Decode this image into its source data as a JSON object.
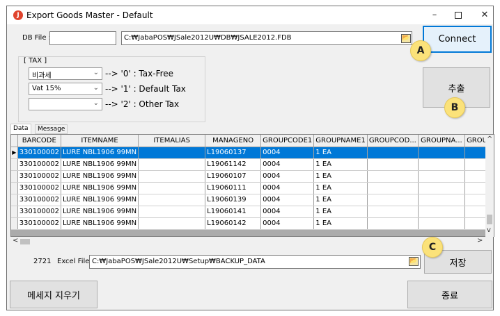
{
  "window": {
    "title": "Export Goods Master - Default",
    "controls": {
      "minimize": "–",
      "maximize": "",
      "close": "✕"
    }
  },
  "db": {
    "label": "DB File :",
    "path": "C:₩JabaPOS₩JSale2012U₩DB₩JSALE2012.FDB",
    "connect_label": "Connect"
  },
  "tax": {
    "group_title": "[ TAX ]",
    "rows": [
      {
        "combo": "비과세",
        "text": "--> '0' : Tax-Free"
      },
      {
        "combo": "Vat 15%",
        "text": "--> '1' : Default Tax"
      },
      {
        "combo": "",
        "text": "--> '2' : Other Tax"
      }
    ]
  },
  "extract_label": "추출",
  "tabs": {
    "data": "Data",
    "message": "Message"
  },
  "grid": {
    "columns": [
      "BARCODE",
      "ITEMNAME",
      "ITEMALIAS",
      "MANAGENO",
      "GROUPCODE1",
      "GROUPNAME1",
      "GROUPCOD...",
      "GROUPNA...",
      "GROUP"
    ],
    "rows": [
      [
        "330100002",
        "LURE NBL1906 99MN",
        "",
        "L19060137",
        "0004",
        "1 EA",
        "",
        "",
        ""
      ],
      [
        "330100002",
        "LURE NBL1906 99MN",
        "",
        "L19061142",
        "0004",
        "1 EA",
        "",
        "",
        ""
      ],
      [
        "330100002",
        "LURE NBL1906 99MN",
        "",
        "L19060107",
        "0004",
        "1 EA",
        "",
        "",
        ""
      ],
      [
        "330100002",
        "LURE NBL1906 99MN",
        "",
        "L19060111",
        "0004",
        "1 EA",
        "",
        "",
        ""
      ],
      [
        "330100002",
        "LURE NBL1906 99MN",
        "",
        "L19060139",
        "0004",
        "1 EA",
        "",
        "",
        ""
      ],
      [
        "330100002",
        "LURE NBL1906 99MN",
        "",
        "L19060141",
        "0004",
        "1 EA",
        "",
        "",
        ""
      ],
      [
        "330100002",
        "LURE NBL1906 99MN",
        "",
        "L19060142",
        "0004",
        "1 EA",
        "",
        "",
        ""
      ]
    ]
  },
  "scroll": {
    "up": "^",
    "down": "v",
    "left": "<",
    "right": ">"
  },
  "export": {
    "count": "2721",
    "label": "Excel File :",
    "path": "C:₩JabaPOS₩JSale2012U₩Setup₩BACKUP_DATA",
    "save_label": "저장"
  },
  "footer": {
    "clear_message_label": "메세지 지우기",
    "exit_label": "종료"
  },
  "callouts": {
    "a": "A",
    "b": "B",
    "c": "C"
  },
  "icons": {
    "folder": "📂",
    "chevron": "⌄",
    "row_pointer": "▶"
  }
}
